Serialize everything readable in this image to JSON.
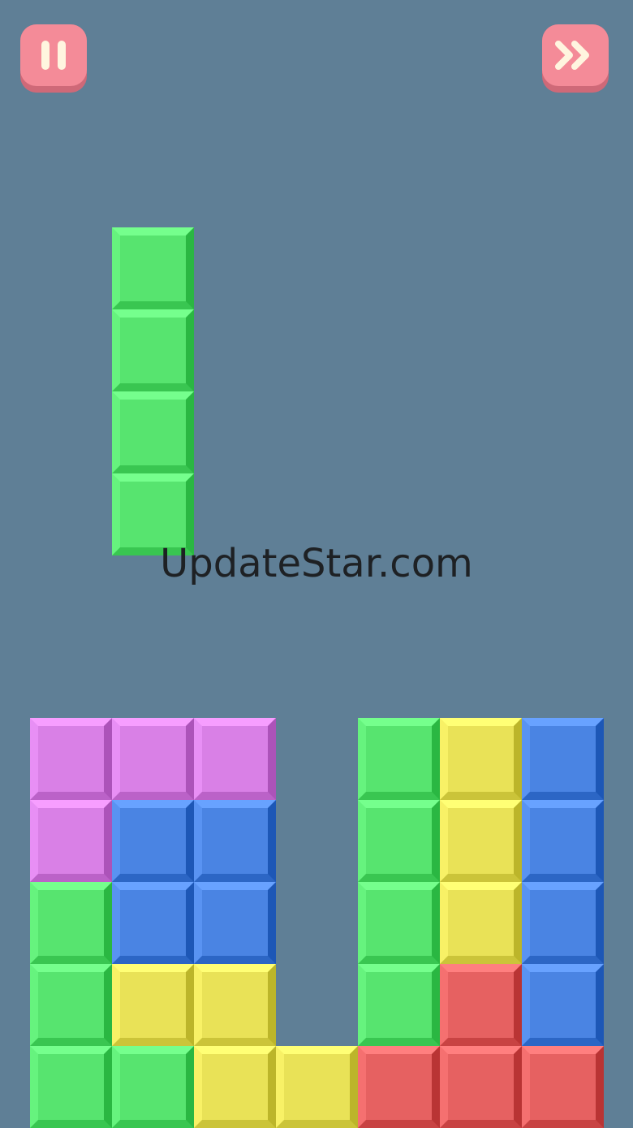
{
  "buttons": {
    "pause": {
      "icon": "pause-icon"
    },
    "skip": {
      "icon": "fast-forward-icon"
    }
  },
  "watermark": "UpdateStar.com",
  "colors": {
    "background": "#5f7f96",
    "button": "#f48b98",
    "button_shadow": "#cf6978",
    "button_icon": "#fff5df",
    "green": "#57e46f",
    "purple": "#d980e6",
    "blue": "#4a84e3",
    "yellow": "#e9e257",
    "red": "#e66161"
  },
  "falling_piece": {
    "color": "green",
    "cells": [
      [
        1,
        0
      ],
      [
        1,
        1
      ],
      [
        1,
        2
      ],
      [
        1,
        3
      ]
    ]
  },
  "stack": [
    [
      [
        "purple"
      ],
      [
        "purple"
      ],
      [
        "purple"
      ],
      [
        null
      ],
      [
        "green"
      ],
      [
        "yellow"
      ],
      [
        "blue"
      ]
    ],
    [
      [
        "purple"
      ],
      [
        "blue"
      ],
      [
        "blue"
      ],
      [
        null
      ],
      [
        "green"
      ],
      [
        "yellow"
      ],
      [
        "blue"
      ]
    ],
    [
      [
        "green"
      ],
      [
        "blue"
      ],
      [
        "blue"
      ],
      [
        null
      ],
      [
        "green"
      ],
      [
        "yellow"
      ],
      [
        "blue"
      ]
    ],
    [
      [
        "green"
      ],
      [
        "yellow"
      ],
      [
        "yellow"
      ],
      [
        null
      ],
      [
        "green"
      ],
      [
        "red"
      ],
      [
        "blue"
      ]
    ],
    [
      [
        "green"
      ],
      [
        "green"
      ],
      [
        "yellow"
      ],
      [
        "yellow"
      ],
      [
        "red"
      ],
      [
        "red"
      ],
      [
        "red"
      ]
    ]
  ]
}
